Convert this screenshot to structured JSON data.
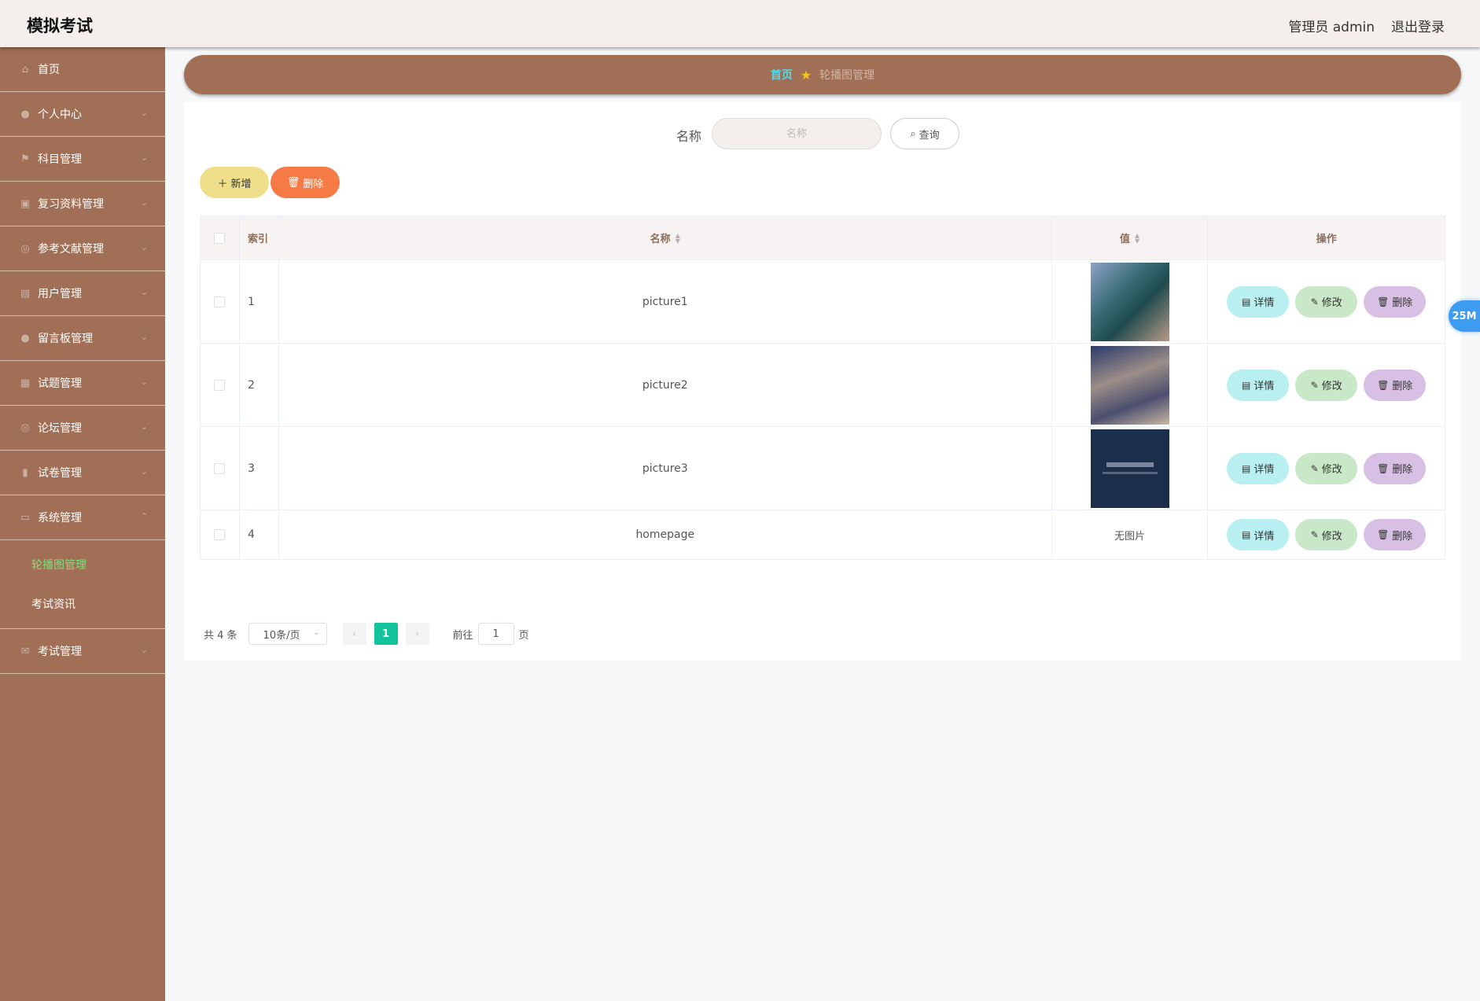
{
  "header": {
    "app_title": "模拟考试",
    "admin_label": "管理员 admin",
    "logout_label": "退出登录"
  },
  "sidebar": {
    "items": [
      {
        "label": "首页",
        "icon": "home-icon",
        "glyph": "⌂",
        "chev": ""
      },
      {
        "label": "个人中心",
        "icon": "user-icon",
        "glyph": "●",
        "chev": "⌄"
      },
      {
        "label": "科目管理",
        "icon": "flag-icon",
        "glyph": "⚑",
        "chev": "⌄"
      },
      {
        "label": "复习资料管理",
        "icon": "document-icon",
        "glyph": "▣",
        "chev": "⌄"
      },
      {
        "label": "参考文献管理",
        "icon": "compass-icon",
        "glyph": "◎",
        "chev": "⌄"
      },
      {
        "label": "用户管理",
        "icon": "podium-icon",
        "glyph": "▤",
        "chev": "⌄"
      },
      {
        "label": "留言板管理",
        "icon": "person-icon",
        "glyph": "●",
        "chev": "⌄"
      },
      {
        "label": "试题管理",
        "icon": "grid-icon",
        "glyph": "▦",
        "chev": "⌄"
      },
      {
        "label": "论坛管理",
        "icon": "compass-icon",
        "glyph": "◎",
        "chev": "⌄"
      },
      {
        "label": "试卷管理",
        "icon": "microphone-icon",
        "glyph": "▮",
        "chev": "⌄"
      },
      {
        "label": "系统管理",
        "icon": "chat-icon",
        "glyph": "▭",
        "chev": "⌃"
      }
    ],
    "submenu": [
      {
        "label": "轮播图管理",
        "active": true
      },
      {
        "label": "考试资讯",
        "active": false
      }
    ],
    "last_item": {
      "label": "考试管理",
      "icon": "mail-icon",
      "glyph": "✉",
      "chev": "⌄"
    }
  },
  "breadcrumb": {
    "home": "首页",
    "current": "轮播图管理"
  },
  "search": {
    "label": "名称",
    "placeholder": "名称",
    "button_label": "查询"
  },
  "actions": {
    "add_label": "新增",
    "delete_label": "删除"
  },
  "table": {
    "columns": [
      "索引",
      "名称",
      "值",
      "操作"
    ],
    "rows": [
      {
        "index": "1",
        "name": "picture1",
        "value": "image",
        "thumb": "thumb1"
      },
      {
        "index": "2",
        "name": "picture2",
        "value": "image",
        "thumb": "thumb2"
      },
      {
        "index": "3",
        "name": "picture3",
        "value": "image",
        "thumb": "thumb3"
      },
      {
        "index": "4",
        "name": "homepage",
        "value": "无图片",
        "thumb": ""
      }
    ],
    "row_actions": {
      "detail": "详情",
      "edit": "修改",
      "delete": "删除"
    }
  },
  "pagination": {
    "total_text": "共 4 条",
    "page_size": "10条/页",
    "current_page": "1",
    "goto_label": "前往",
    "goto_value": "1",
    "page_suffix": "页"
  },
  "floating_badge": "25M",
  "colors": {
    "sidebar_bg": "#a06f56",
    "header_bg": "#f4eeed",
    "accent_green": "#13c39c",
    "active_submenu": "#7fe07a"
  }
}
